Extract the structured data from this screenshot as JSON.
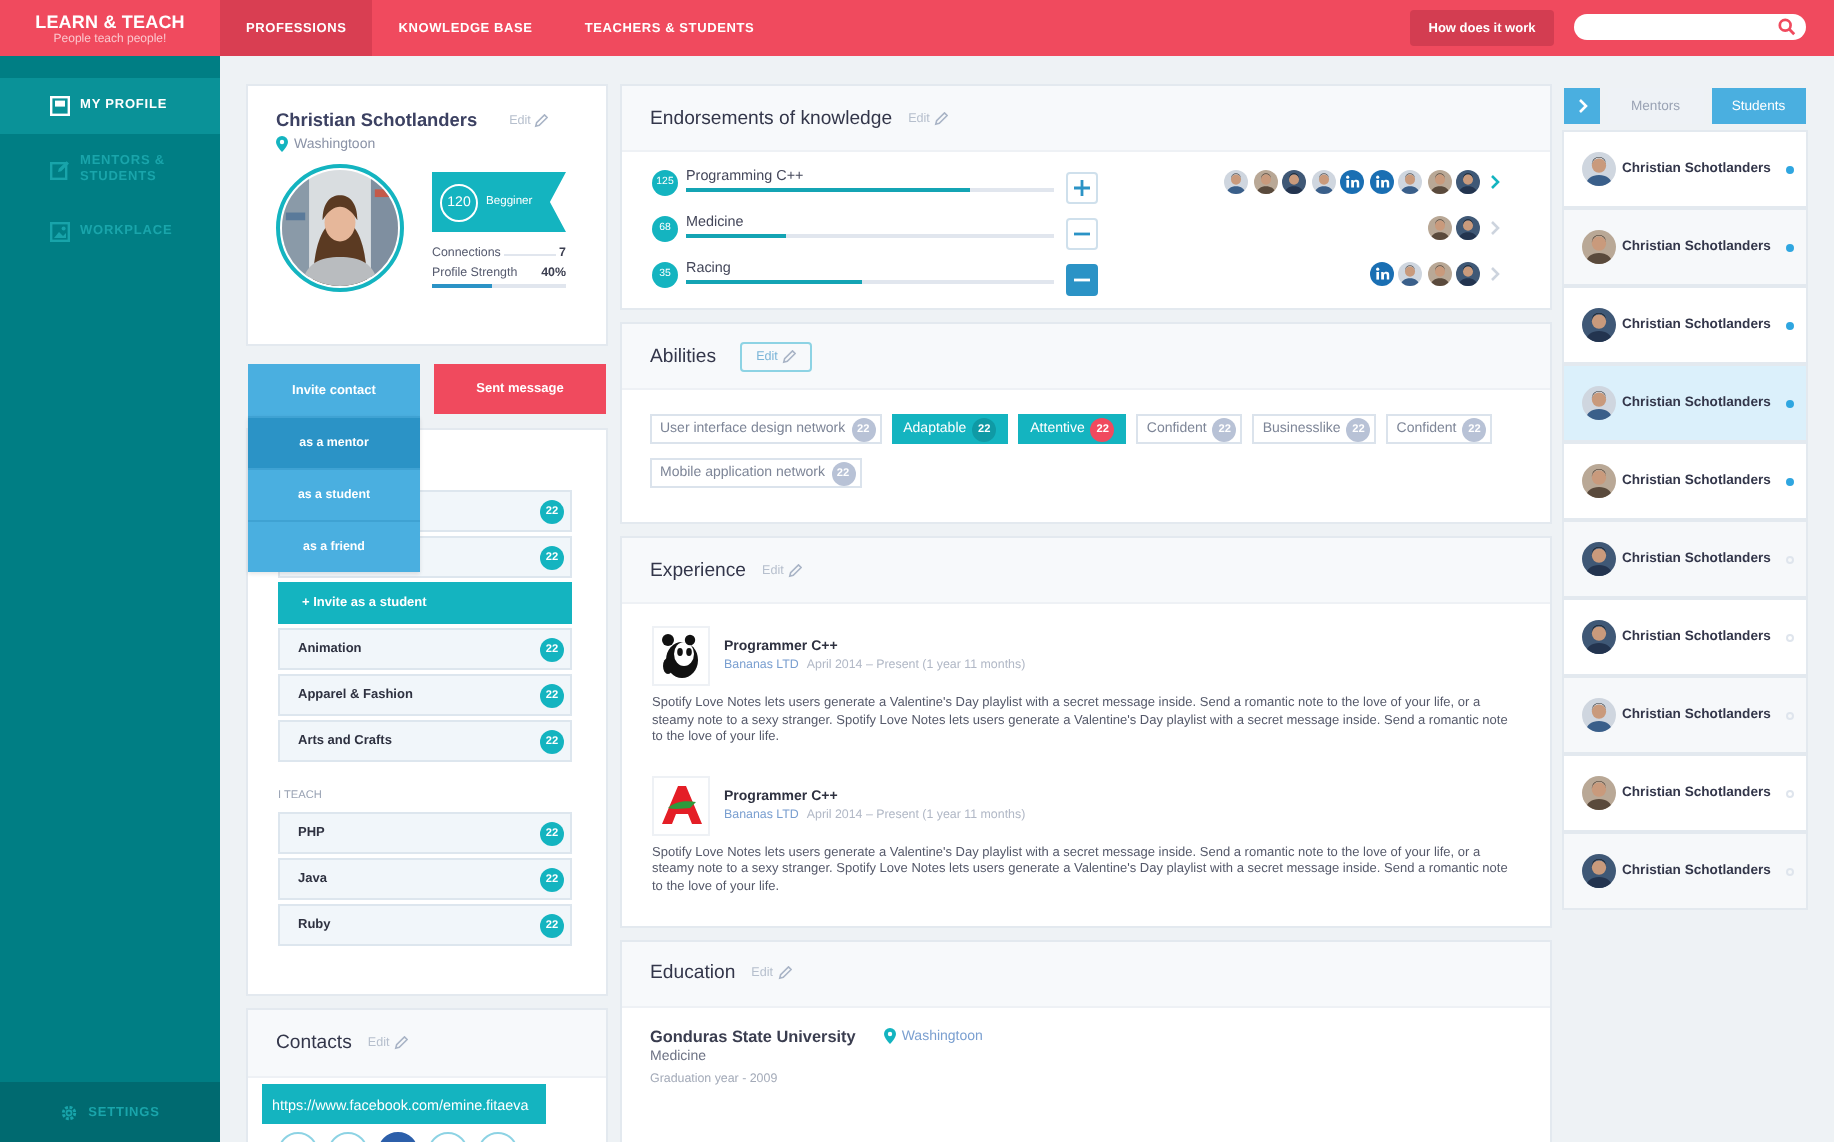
{
  "app": {
    "logo": "LEARN & TEACH",
    "tagline": "People teach people!"
  },
  "nav": {
    "tabs": [
      {
        "label": "PROFESSIONS",
        "selected": true
      },
      {
        "label": "KNOWLEDGE BASE",
        "selected": false
      },
      {
        "label": "TEACHERS & STUDENTS",
        "selected": false
      }
    ],
    "help_button": "How does it work"
  },
  "sidebar": {
    "items": [
      {
        "label": "MY PROFILE",
        "selected": true
      },
      {
        "label": "MENTORS & STUDENTS",
        "selected": false
      },
      {
        "label": "WORKPLACE",
        "selected": false
      }
    ],
    "settings": "SETTINGS"
  },
  "profile": {
    "name": "Christian Schotlanders",
    "edit": "Edit",
    "location": "Washingtoon",
    "score": "120",
    "rank": "Begginer",
    "stats": [
      {
        "label": "Connections",
        "value": "7"
      },
      {
        "label": "Profile Strength",
        "value": "40%",
        "level": 0.45
      }
    ]
  },
  "actions": {
    "invite": {
      "label": "Invite contact",
      "expanded": true,
      "options": [
        {
          "label": "as a mentor",
          "selected": true
        },
        {
          "label": "as a student",
          "selected": false
        },
        {
          "label": "as a friend",
          "selected": false
        }
      ]
    },
    "message": "Sent message"
  },
  "learning": {
    "items": [
      {
        "kind": "topic",
        "count": "22"
      },
      {
        "kind": "topic",
        "count": "22"
      },
      {
        "kind": "invite",
        "label": "+ Invite as a student"
      },
      {
        "kind": "topic",
        "label": "Animation",
        "count": "22"
      },
      {
        "kind": "topic",
        "label": "Apparel & Fashion",
        "count": "22"
      },
      {
        "kind": "topic",
        "label": "Arts and Crafts",
        "count": "22"
      }
    ]
  },
  "teaching": {
    "heading": "I TEACH",
    "items": [
      {
        "kind": "topic",
        "label": "PHP",
        "count": "22"
      },
      {
        "kind": "topic",
        "label": "Java",
        "count": "22"
      },
      {
        "kind": "topic",
        "label": "Ruby",
        "count": "22"
      }
    ]
  },
  "contacts": {
    "title": "Contacts",
    "edit": "Edit",
    "tooltip": "https://www.facebook.com/emine.fitaeva",
    "links": [
      {
        "selected": false
      },
      {
        "selected": false
      },
      {
        "selected": true
      },
      {
        "selected": false
      },
      {
        "selected": false
      }
    ]
  },
  "endorsements": {
    "title": "Endorsements of knowledge",
    "edit": "Edit",
    "skills": [
      {
        "count": "125",
        "label": "Programming C++",
        "level": 0.77,
        "kind": "plus",
        "active": false,
        "expanded": true,
        "endorsers": [
          {
            "kind": "avatar"
          },
          {
            "kind": "avatar"
          },
          {
            "kind": "avatar"
          },
          {
            "kind": "avatar"
          },
          {
            "kind": "network"
          },
          {
            "kind": "network"
          },
          {
            "kind": "avatar"
          },
          {
            "kind": "avatar"
          },
          {
            "kind": "avatar"
          }
        ]
      },
      {
        "count": "68",
        "label": "Medicine",
        "level": 0.27,
        "kind": "minus",
        "active": false,
        "expanded": false,
        "endorsers": [
          {
            "kind": "avatar"
          },
          {
            "kind": "avatar"
          }
        ]
      },
      {
        "count": "35",
        "label": "Racing",
        "level": 0.48,
        "kind": "minus",
        "active": true,
        "expanded": false,
        "endorsers": [
          {
            "kind": "network"
          },
          {
            "kind": "avatar"
          },
          {
            "kind": "avatar"
          },
          {
            "kind": "avatar"
          }
        ]
      }
    ]
  },
  "abilities": {
    "title": "Abilities",
    "edit": "Edit",
    "tags": [
      {
        "label": "User interface design network",
        "count": "22",
        "selected": false,
        "alert": false
      },
      {
        "label": "Adaptable",
        "count": "22",
        "selected": true,
        "alert": false
      },
      {
        "label": "Attentive",
        "count": "22",
        "selected": true,
        "alert": true
      },
      {
        "label": "Confident",
        "count": "22",
        "selected": false,
        "alert": false
      },
      {
        "label": "Businesslike",
        "count": "22",
        "selected": false,
        "alert": false
      },
      {
        "label": "Confident",
        "count": "22",
        "selected": false,
        "alert": false
      },
      {
        "label": "Mobile application network",
        "count": "22",
        "selected": false,
        "alert": false
      }
    ]
  },
  "experience": {
    "title": "Experience",
    "edit": "Edit",
    "jobs": [
      {
        "kind": "panda",
        "title": "Programmer  C++",
        "company": "Bananas LTD",
        "period": "April 2014 – Present (1 year 11 months)",
        "description": "Spotify Love Notes lets users generate a Valentine's Day playlist with a secret message inside. Send a romantic note to the love of your life, or a steamy note to a sexy stranger. Spotify Love Notes lets users generate a Valentine's Day playlist with a secret message inside. Send a romantic note to the love of your life."
      },
      {
        "kind": "bird",
        "title": "Programmer  C++",
        "company": "Bananas LTD",
        "period": "April 2014 – Present (1 year 11 months)",
        "description": "Spotify Love Notes lets users generate a Valentine's Day playlist with a secret message inside. Send a romantic note to the love of your life, or a steamy note to a sexy stranger. Spotify Love Notes lets users generate a Valentine's Day playlist with a secret message inside. Send a romantic note to the love of your life."
      }
    ]
  },
  "education": {
    "title": "Education",
    "edit": "Edit",
    "school": "Gonduras State University",
    "location": "Washingtoon",
    "field": "Medicine",
    "graduation": "Graduation year - 2009"
  },
  "people": {
    "tabs": [
      {
        "label": "Mentors",
        "selected": false
      },
      {
        "label": "Students",
        "selected": true
      }
    ],
    "list": [
      {
        "name": "Christian Schotlanders",
        "online": true,
        "selected": false
      },
      {
        "name": "Christian Schotlanders",
        "online": true,
        "selected": false
      },
      {
        "name": "Christian Schotlanders",
        "online": true,
        "selected": false
      },
      {
        "name": "Christian Schotlanders",
        "online": true,
        "selected": true
      },
      {
        "name": "Christian Schotlanders",
        "online": true,
        "selected": false
      },
      {
        "name": "Christian Schotlanders",
        "online": false,
        "selected": false
      },
      {
        "name": "Christian Schotlanders",
        "online": false,
        "selected": false
      },
      {
        "name": "Christian Schotlanders",
        "online": false,
        "selected": false
      },
      {
        "name": "Christian Schotlanders",
        "online": false,
        "selected": false
      },
      {
        "name": "Christian Schotlanders",
        "online": false,
        "selected": false
      }
    ]
  }
}
